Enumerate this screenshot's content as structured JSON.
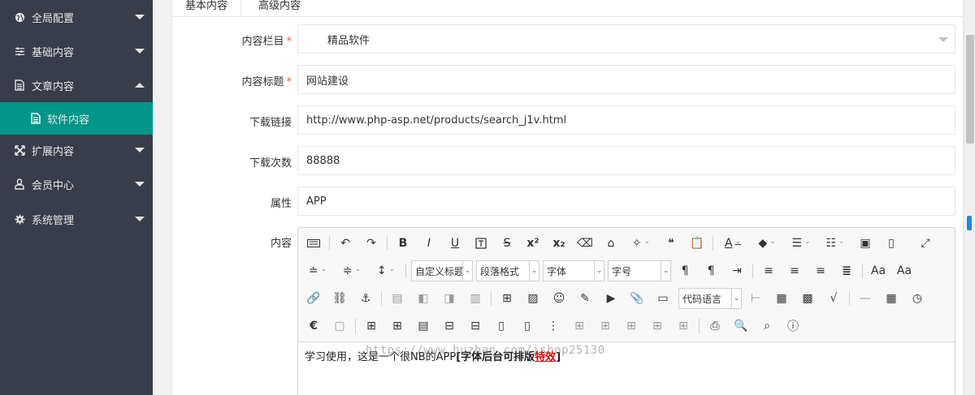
{
  "sidebar": {
    "items": [
      {
        "label": "全局配置",
        "icon": "globe-icon"
      },
      {
        "label": "基础内容",
        "icon": "sliders-icon"
      },
      {
        "label": "文章内容",
        "icon": "document-icon"
      },
      {
        "label": "软件内容",
        "icon": "document-icon"
      },
      {
        "label": "扩展内容",
        "icon": "expand-icon"
      },
      {
        "label": "会员中心",
        "icon": "user-icon"
      },
      {
        "label": "系统管理",
        "icon": "gear-icon"
      }
    ]
  },
  "tabs": [
    {
      "label": "基本内容"
    },
    {
      "label": "高级内容"
    }
  ],
  "form": {
    "category": {
      "label": "内容栏目",
      "value": "精品软件"
    },
    "title": {
      "label": "内容标题",
      "value": "网站建设"
    },
    "download_link": {
      "label": "下载链接",
      "value": "http://www.php-asp.net/products/search_j1v.html"
    },
    "download_count": {
      "label": "下载次数",
      "value": "88888"
    },
    "attribute": {
      "label": "属性",
      "value": "APP"
    },
    "content": {
      "label": "内容"
    }
  },
  "editor": {
    "selects": {
      "custom_heading": "自定义标题",
      "paragraph_format": "段落格式",
      "font": "字体",
      "font_size": "字号",
      "code_language": "代码语言"
    },
    "body_plain": "学习使用，这是一个很NB的APP",
    "body_bold": "[字体后台可排版",
    "body_red": "特效",
    "body_end": "]"
  },
  "watermark": "https://www.huzhan.com/ishop25130",
  "colors": {
    "sidebar_bg": "#393d49",
    "sidebar_active": "#009688",
    "required": "#ff5722"
  }
}
